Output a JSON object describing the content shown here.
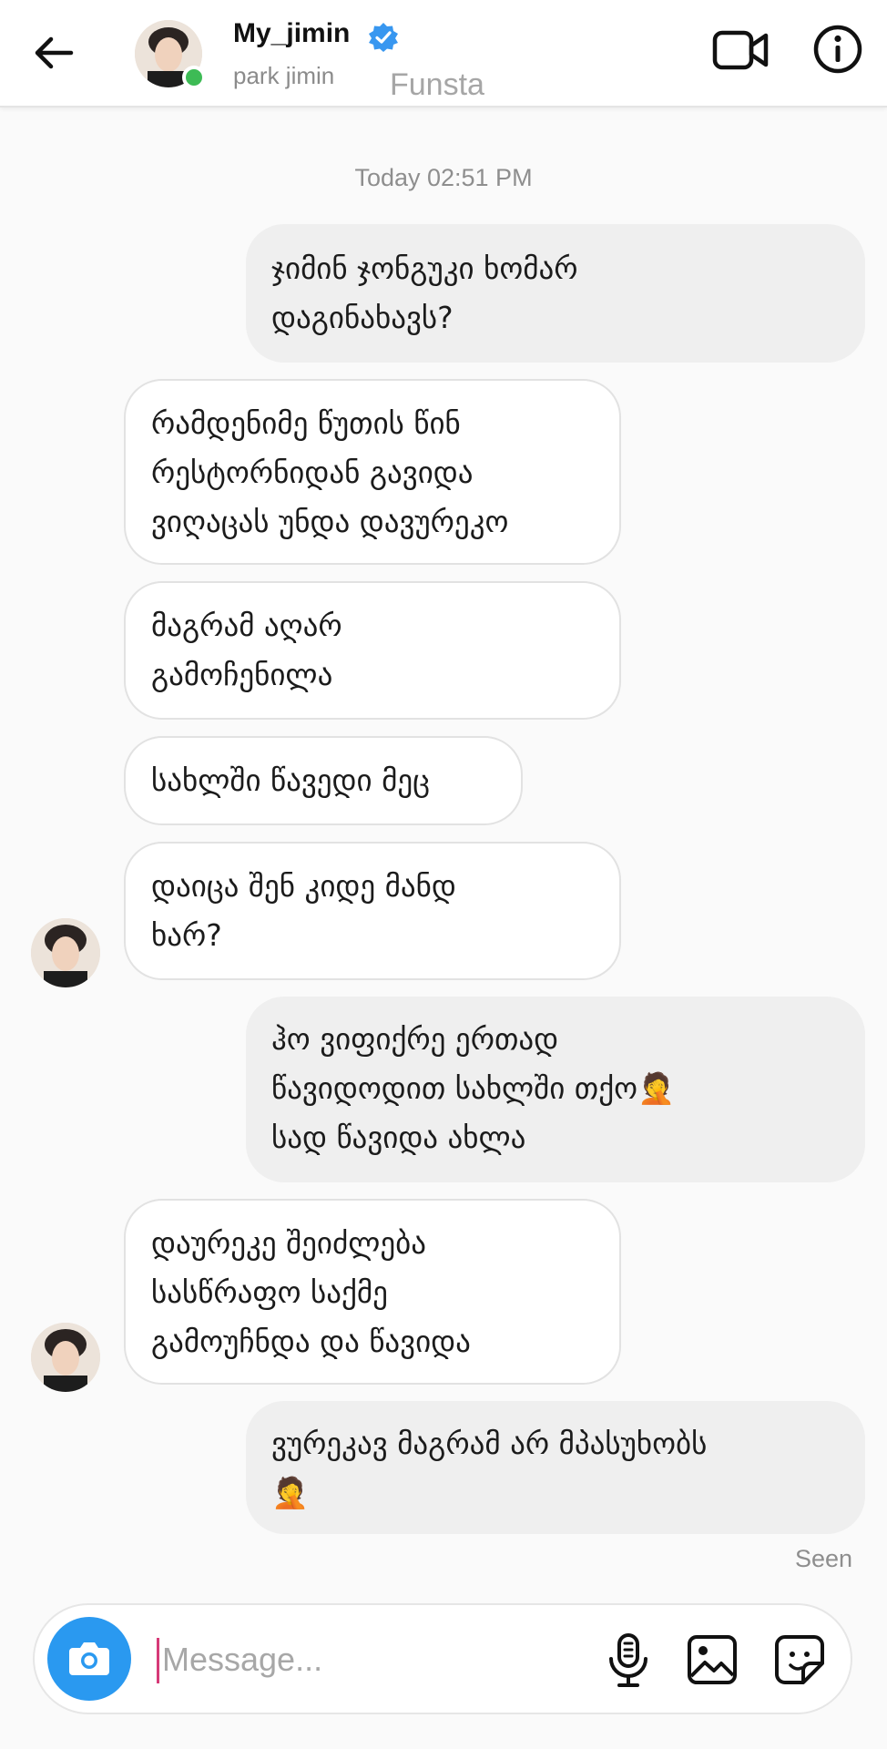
{
  "header": {
    "username": "My_jimin",
    "subname": "park jimin",
    "overlay_label": "Funsta",
    "verified_color": "#3897f0",
    "online_color": "#3dbb55"
  },
  "timestamp": "Today 02:51 PM",
  "messages": [
    {
      "direction": "out",
      "lines": [
        "ჯიმინ ჯონგუკი ხომარ",
        "დაგინახავს?"
      ]
    },
    {
      "direction": "in",
      "lines": [
        "რამდენიმე წუთის წინ",
        "რესტორნიდან გავიდა",
        "ვიღაცას უნდა დავურეკო"
      ]
    },
    {
      "direction": "in",
      "lines": [
        "მაგრამ აღარ",
        "გამოჩენილა"
      ]
    },
    {
      "direction": "in",
      "lines": [
        "სახლში წავედი მეც"
      ]
    },
    {
      "direction": "in",
      "lines": [
        "დაიცა შენ კიდე მანდ",
        "ხარ?"
      ]
    },
    {
      "direction": "out",
      "lines": [
        "ჰო ვიფიქრე ერთად",
        "წავიდოდით სახლში თქო🤦",
        "სად წავიდა ახლა"
      ]
    },
    {
      "direction": "in",
      "lines": [
        "დაურეკე შეიძლება",
        "სასწრაფო საქმე",
        "გამოუჩნდა და წავიდა"
      ]
    },
    {
      "direction": "out",
      "lines": [
        "ვურეკავ მაგრამ არ მპასუხობს",
        "🤦"
      ]
    }
  ],
  "seen_label": "Seen",
  "composer": {
    "placeholder": "Message...",
    "value": "",
    "camera_color": "#2a99f0"
  },
  "icons": {
    "back": "arrow-left-icon",
    "video": "video-camera-icon",
    "info": "info-icon",
    "camera": "camera-icon",
    "mic": "microphone-icon",
    "gallery": "image-icon",
    "sticker": "sticker-icon"
  }
}
